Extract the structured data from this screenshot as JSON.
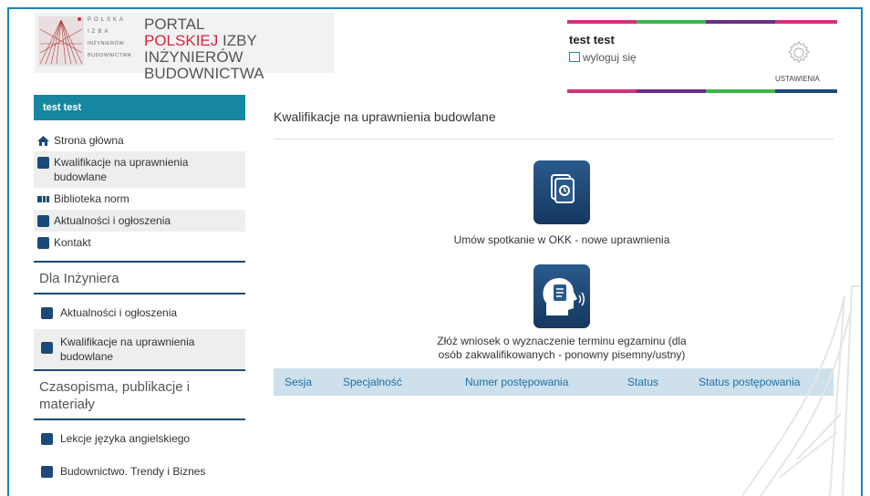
{
  "logo": {
    "line1": "POLSKA",
    "line2": "IZBA",
    "line3": "INŻYNIERÓW",
    "line4": "BUDOWNICTWA",
    "title_line1": "PORTAL",
    "title_line2_red": "POLSKIEJ",
    "title_line2_rest": " IZBY INŻYNIERÓW",
    "title_line3": "BUDOWNICTWA"
  },
  "user": {
    "name": "test test",
    "logout_label": "wyloguj się",
    "settings_label": "USTAWIENIA"
  },
  "colors": {
    "accent_blue": "#1e82c4",
    "teal": "#1687a0",
    "navy": "#1b4a7a",
    "stripe_pink": "#d4307a",
    "stripe_green": "#3cb54a",
    "stripe_purple": "#6a2d8a",
    "stripe_navy": "#1b4a7a"
  },
  "sidebar": {
    "user_label": "test test",
    "items": [
      {
        "label": "Strona główna",
        "icon": "home-icon"
      },
      {
        "label": "Kwalifikacje na uprawnienia budowlane",
        "icon": "qualification-icon"
      },
      {
        "label": "Biblioteka norm",
        "icon": "library-icon"
      },
      {
        "label": "Aktualności i ogłoszenia",
        "icon": "news-icon"
      },
      {
        "label": "Kontakt",
        "icon": "headset-icon"
      }
    ],
    "section1": "Dla Inżyniera",
    "section1_items": [
      {
        "label": "Aktualności i ogłoszenia",
        "icon": "news-icon"
      },
      {
        "label": "Kwalifikacje na uprawnienia budowlane",
        "icon": "qualification-icon"
      }
    ],
    "section2": "Czasopisma, publikacje i materiały",
    "section2_items": [
      {
        "label": "Lekcje języka angielskiego",
        "icon": "book-icon"
      },
      {
        "label": "Budownictwo. Trendy i Biznes",
        "icon": "book-icon"
      }
    ]
  },
  "main": {
    "title": "Kwalifikacje na uprawnienia budowlane",
    "tile1_label": "Umów spotkanie w OKK - nowe uprawnienia",
    "tile2_label_line1": "Złóż wniosek o wyznaczenie terminu egzaminu (dla",
    "tile2_label_line2": "osób zakwalifikowanych - ponowny pisemny/ustny)",
    "table_headers": [
      "Sesja",
      "Specjalność",
      "Numer postępowania",
      "Status",
      "Status postępowania"
    ]
  }
}
